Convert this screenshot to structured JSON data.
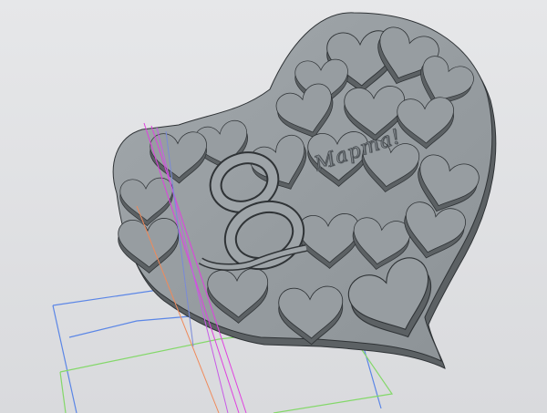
{
  "model": {
    "number_glyph": "8",
    "caption_text": "Марта!"
  },
  "colors": {
    "background": "#dedfe1",
    "face": "#989ea2",
    "face_dark": "#81878b",
    "side": "#5c6164",
    "edge": "#2f3336",
    "sketch_blue": "#5b86e6",
    "sketch_green": "#84d86a",
    "axis_magenta": "#e040e0",
    "axis_orange": "#f08a5a"
  },
  "icons": {
    "viewport": "3d-cad-viewport"
  }
}
